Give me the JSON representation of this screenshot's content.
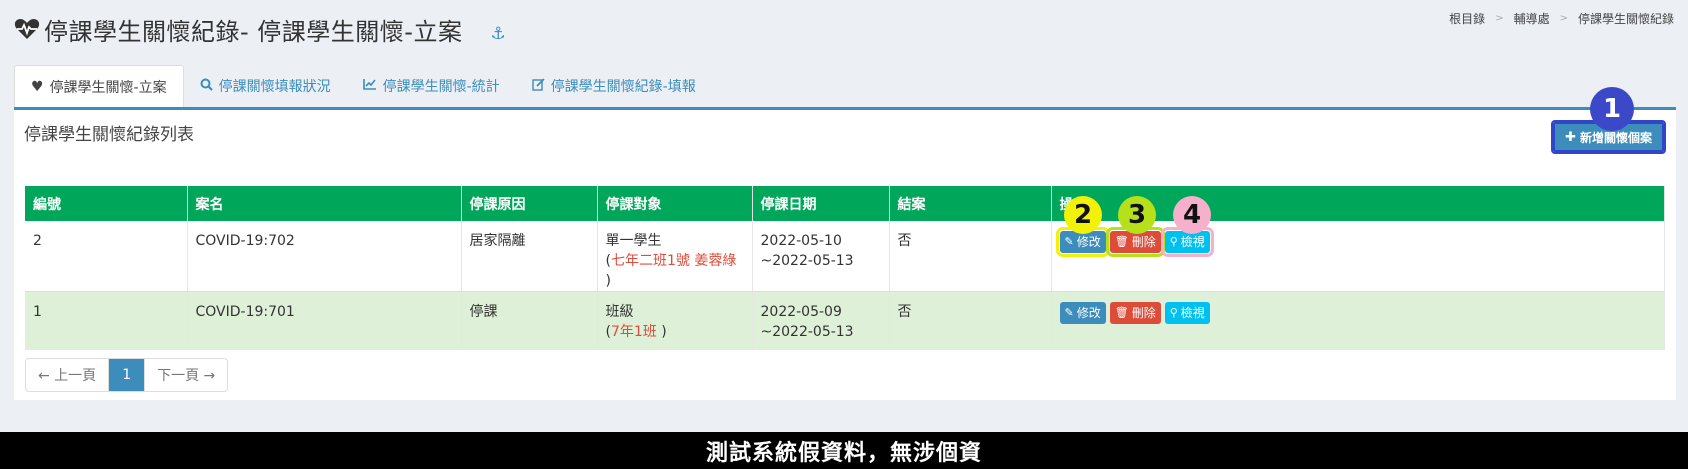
{
  "header": {
    "title": "停課學生關懷紀錄- 停課學生關懷-立案",
    "title_icon": "heartbeat-icon",
    "anchor_icon": "anchor-icon"
  },
  "breadcrumb": {
    "items": [
      "根目錄",
      "輔導處",
      "停課學生關懷紀錄"
    ],
    "separator": ">"
  },
  "tabs": [
    {
      "label": "停課學生關懷-立案",
      "icon": "heart-icon",
      "active": true
    },
    {
      "label": "停課關懷填報狀況",
      "icon": "search-icon",
      "active": false
    },
    {
      "label": "停課學生關懷-統計",
      "icon": "line-chart-icon",
      "active": false
    },
    {
      "label": "停課學生關懷紀錄-填報",
      "icon": "edit-icon",
      "active": false
    }
  ],
  "box": {
    "title": "停課學生關懷紀錄列表",
    "add_button": "新增關懷個案"
  },
  "markers": [
    "1",
    "2",
    "3",
    "4"
  ],
  "table": {
    "columns": [
      "編號",
      "案名",
      "停課原因",
      "停課對象",
      "停課日期",
      "結案",
      "操作"
    ],
    "rows": [
      {
        "id": "2",
        "name": "COVID-19:702",
        "reason": "居家隔離",
        "target": "單一學生",
        "target_detail": "七年二班1號 姜蓉綠",
        "date_start": "2022-05-10",
        "date_end": "~2022-05-13",
        "closed": "否"
      },
      {
        "id": "1",
        "name": "COVID-19:701",
        "reason": "停課",
        "target": "班級",
        "target_detail": "7年1班",
        "date_start": "2022-05-09",
        "date_end": "~2022-05-13",
        "closed": "否"
      }
    ],
    "actions": {
      "edit": "修改",
      "delete": "刪除",
      "view": "檢視"
    }
  },
  "pager": {
    "prev": "← 上一頁",
    "current": "1",
    "next": "下一頁 →"
  },
  "footer": "測試系統假資料，無涉個資",
  "colors": {
    "primary": "#3c8dbc",
    "success": "#00a65a",
    "danger": "#dd4b39",
    "info": "#00c0ef",
    "row_alt": "#dff0d8"
  }
}
